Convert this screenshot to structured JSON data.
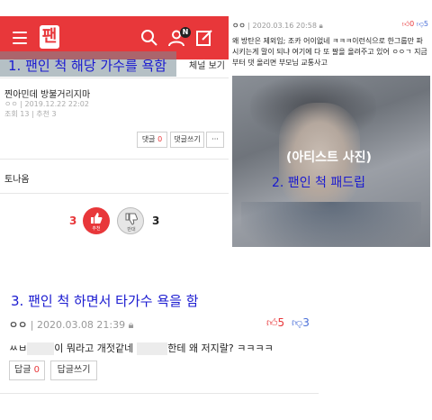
{
  "left_panel": {
    "logo_text": "팬",
    "badge": "N",
    "annotation": "1. 팬인 척 해당 가수를 욕함",
    "sub_tab_label": "체널 보기",
    "post": {
      "title": "찐아민데 방불거리지마",
      "meta": "ㅇㅇ | 2019.12.22 22:02",
      "meta2": "조회 13 | 추천 3"
    },
    "buttons": {
      "comment_label": "댓글",
      "comment_count": "0",
      "write_comment": "댓글쓰기",
      "more": "···"
    },
    "nickname": "토나옴",
    "votes": {
      "up_count": "3",
      "up_label": "추천",
      "down_label": "반대",
      "down_count": "3"
    }
  },
  "right_panel": {
    "dots": "ㅇㅇ",
    "date": "2020.03.16 20:58",
    "up_votes": "0",
    "down_votes": "5",
    "body": "왜 방탄은 제외임; 조카 어이없네 ㅋㅋㅋ이런식으로 한그룹만 파시키는게 말이 되냐 여기에 다 또 팔을 올려주고 있어 ㅇㅇㄱ 지금부터 댓 올리면 부모님 교통사고",
    "photo_label": "(아티스트 사진)",
    "annotation": "2. 팬인 척 패드립"
  },
  "bottom": {
    "annotation": "3. 팬인 척 하면서 타가수 욕을 함",
    "dots": "ㅇㅇ",
    "date": "2020.03.08 21:39",
    "up_votes": "5",
    "down_votes": "3",
    "text_part1": "ㅆㅂ",
    "text_part2": "이 뭐라고 개젓같네",
    "text_part3": "한테 왜 저지랄? ㅋㅋㅋㅋ",
    "reply_label": "답글",
    "reply_count": "0",
    "write_reply": "답글쓰기"
  },
  "colors": {
    "brand_red": "#e8373a",
    "annotation_blue": "#1a1ad0",
    "down_blue": "#4a6fd8"
  }
}
